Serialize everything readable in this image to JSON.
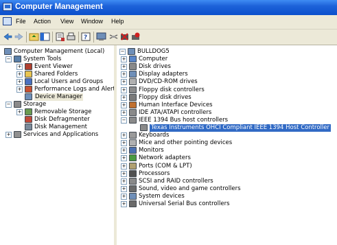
{
  "window": {
    "title": "Computer Management"
  },
  "menu": [
    "File",
    "Action",
    "View",
    "Window",
    "Help"
  ],
  "toolbar_icons": [
    "back-arrow-icon",
    "forward-arrow-icon",
    "up-folder-icon",
    "show-hide-tree-icon",
    "properties-icon",
    "print-icon",
    "help-icon",
    "console-icon",
    "scan-hardware-icon",
    "uninstall-icon",
    "disable-device-icon"
  ],
  "left_tree": [
    {
      "label": "Computer Management (Local)",
      "icon": "computer-management-icon",
      "color": "#6f8fb8"
    },
    {
      "label": "System Tools",
      "icon": "system-tools-icon",
      "color": "#5a7fa8"
    },
    {
      "label": "Event Viewer",
      "icon": "event-viewer-icon",
      "color": "#b04030"
    },
    {
      "label": "Shared Folders",
      "icon": "shared-folders-icon",
      "color": "#e8c450"
    },
    {
      "label": "Local Users and Groups",
      "icon": "users-icon",
      "color": "#4a70c0"
    },
    {
      "label": "Performance Logs and Alerts",
      "icon": "performance-icon",
      "color": "#c85030"
    },
    {
      "label": "Device Manager",
      "icon": "device-manager-icon",
      "color": "#6f8fb8"
    },
    {
      "label": "Storage",
      "icon": "storage-icon",
      "color": "#8a8a8a"
    },
    {
      "label": "Removable Storage",
      "icon": "removable-storage-icon",
      "color": "#6a9a50"
    },
    {
      "label": "Disk Defragmenter",
      "icon": "defragmenter-icon",
      "color": "#c04838"
    },
    {
      "label": "Disk Management",
      "icon": "disk-management-icon",
      "color": "#7a8a9a"
    },
    {
      "label": "Services and Applications",
      "icon": "services-icon",
      "color": "#909090"
    }
  ],
  "right_tree": [
    {
      "label": "BULLDOG5",
      "icon": "computer-icon",
      "color": "#6f8fb8"
    },
    {
      "label": "Computer",
      "icon": "computer-icon",
      "color": "#5a86c8"
    },
    {
      "label": "Disk drives",
      "icon": "disk-drive-icon",
      "color": "#8a8a8a"
    },
    {
      "label": "Display adapters",
      "icon": "display-adapter-icon",
      "color": "#6f8fb8"
    },
    {
      "label": "DVD/CD-ROM drives",
      "icon": "cdrom-icon",
      "color": "#b0b0b0"
    },
    {
      "label": "Floppy disk controllers",
      "icon": "floppy-controller-icon",
      "color": "#8a8a8a"
    },
    {
      "label": "Floppy disk drives",
      "icon": "floppy-drive-icon",
      "color": "#7a7a7a"
    },
    {
      "label": "Human Interface Devices",
      "icon": "hid-icon",
      "color": "#c07030"
    },
    {
      "label": "IDE ATA/ATAPI controllers",
      "icon": "ide-icon",
      "color": "#8a8a8a"
    },
    {
      "label": "IEEE 1394 Bus host controllers",
      "icon": "ieee1394-icon",
      "color": "#8a8a8a"
    },
    {
      "label": "Texas Instruments OHCI Compliant IEEE 1394 Host Controller",
      "icon": "ieee1394-device-icon",
      "color": "#8a8a8a"
    },
    {
      "label": "Keyboards",
      "icon": "keyboard-icon",
      "color": "#9a9a9a"
    },
    {
      "label": "Mice and other pointing devices",
      "icon": "mouse-icon",
      "color": "#b0b0b0"
    },
    {
      "label": "Monitors",
      "icon": "monitor-icon",
      "color": "#4a6fb0"
    },
    {
      "label": "Network adapters",
      "icon": "network-adapter-icon",
      "color": "#4a9a40"
    },
    {
      "label": "Ports (COM & LPT)",
      "icon": "ports-icon",
      "color": "#b0a070"
    },
    {
      "label": "Processors",
      "icon": "processor-icon",
      "color": "#505050"
    },
    {
      "label": "SCSI and RAID controllers",
      "icon": "scsi-icon",
      "color": "#8a8a8a"
    },
    {
      "label": "Sound, video and game controllers",
      "icon": "sound-icon",
      "color": "#6a6a6a"
    },
    {
      "label": "System devices",
      "icon": "system-devices-icon",
      "color": "#6f8fb8"
    },
    {
      "label": "Universal Serial Bus controllers",
      "icon": "usb-icon",
      "color": "#6a6a6a"
    }
  ],
  "expander": {
    "plus": "+",
    "minus": "−"
  }
}
